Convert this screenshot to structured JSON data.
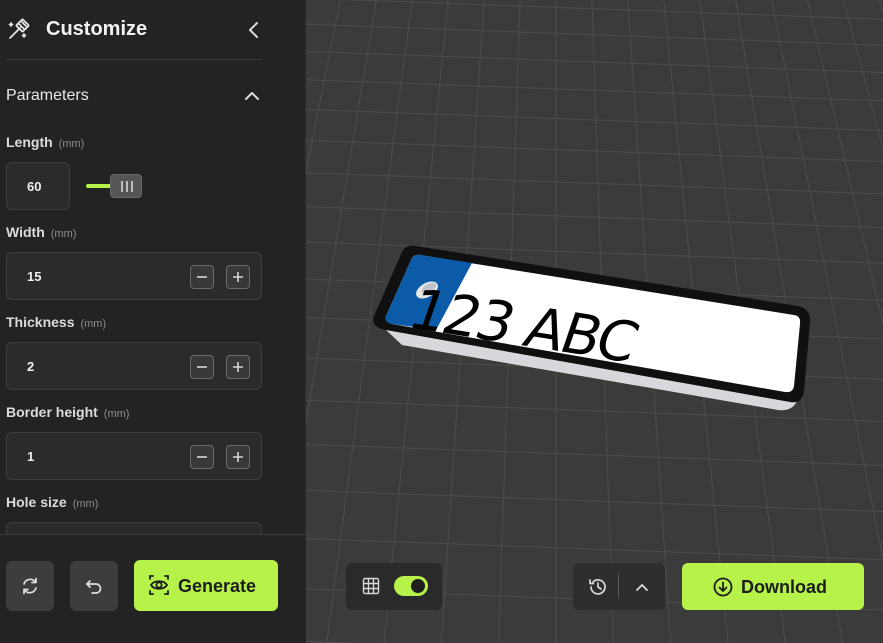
{
  "header": {
    "title": "Customize"
  },
  "section": {
    "title": "Parameters"
  },
  "params": [
    {
      "label": "Length",
      "unit": "(mm)",
      "value": "60",
      "control": "slider",
      "slider_fraction": 1.0
    },
    {
      "label": "Width",
      "unit": "(mm)",
      "value": "15",
      "control": "stepper"
    },
    {
      "label": "Thickness",
      "unit": "(mm)",
      "value": "2",
      "control": "stepper"
    },
    {
      "label": "Border height",
      "unit": "(mm)",
      "value": "1",
      "control": "stepper"
    },
    {
      "label": "Hole size",
      "unit": "(mm)",
      "value": "",
      "control": "stepper"
    }
  ],
  "footer": {
    "generate_label": "Generate"
  },
  "viewport": {
    "plate_text": "123 ABC",
    "grid_toggle_on": true,
    "download_label": "Download"
  },
  "colors": {
    "accent": "#b6f24a",
    "sidebar_bg": "#232323",
    "viewport_bg": "#3b3b3b",
    "plate_blue": "#0b5ba8"
  },
  "icons": {
    "header": "magic-wand-icon",
    "collapse": "chevron-left-icon",
    "section_toggle": "chevron-up-icon",
    "reset": "refresh-icon",
    "undo": "undo-icon",
    "generate": "eye-icon",
    "grid": "grid-icon",
    "history": "history-icon",
    "expand": "chevron-up-icon",
    "download": "download-icon"
  }
}
